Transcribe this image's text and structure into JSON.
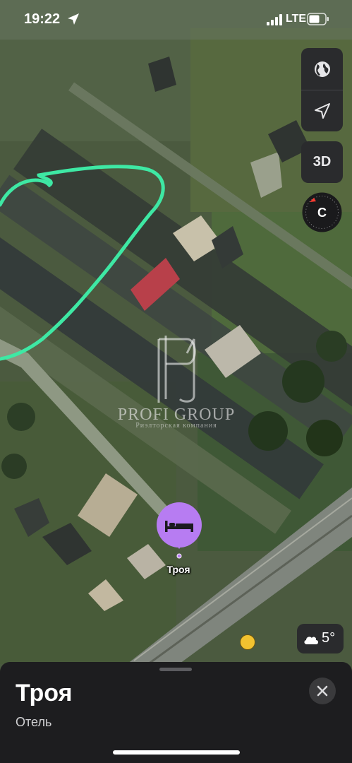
{
  "status_bar": {
    "time": "19:22",
    "network": "LTE",
    "icons": [
      "location-arrow-icon",
      "signal-icon",
      "battery-icon"
    ]
  },
  "map_controls": {
    "map_mode_icon": "globe-icon",
    "locate_icon": "location-arrow-icon",
    "three_d_label": "3D",
    "compass_label": "С"
  },
  "watermark": {
    "monogram": "PC",
    "name": "PROFI GROUP",
    "subtitle": "Риэлторская компания"
  },
  "pin": {
    "icon": "bed-icon",
    "label": "Троя",
    "color": "#b77cf2"
  },
  "weather": {
    "icon": "cloud-icon",
    "temperature": "5°"
  },
  "bus_stop_icon": "bus-icon",
  "place_sheet": {
    "title": "Троя",
    "category": "Отель",
    "close_icon": "close-icon"
  },
  "colors": {
    "highlight_stroke": "#3ee8a4",
    "sheet_bg": "#1d1d1f",
    "control_bg": "#2a2b2d",
    "compass_accent": "#ff3b30"
  }
}
